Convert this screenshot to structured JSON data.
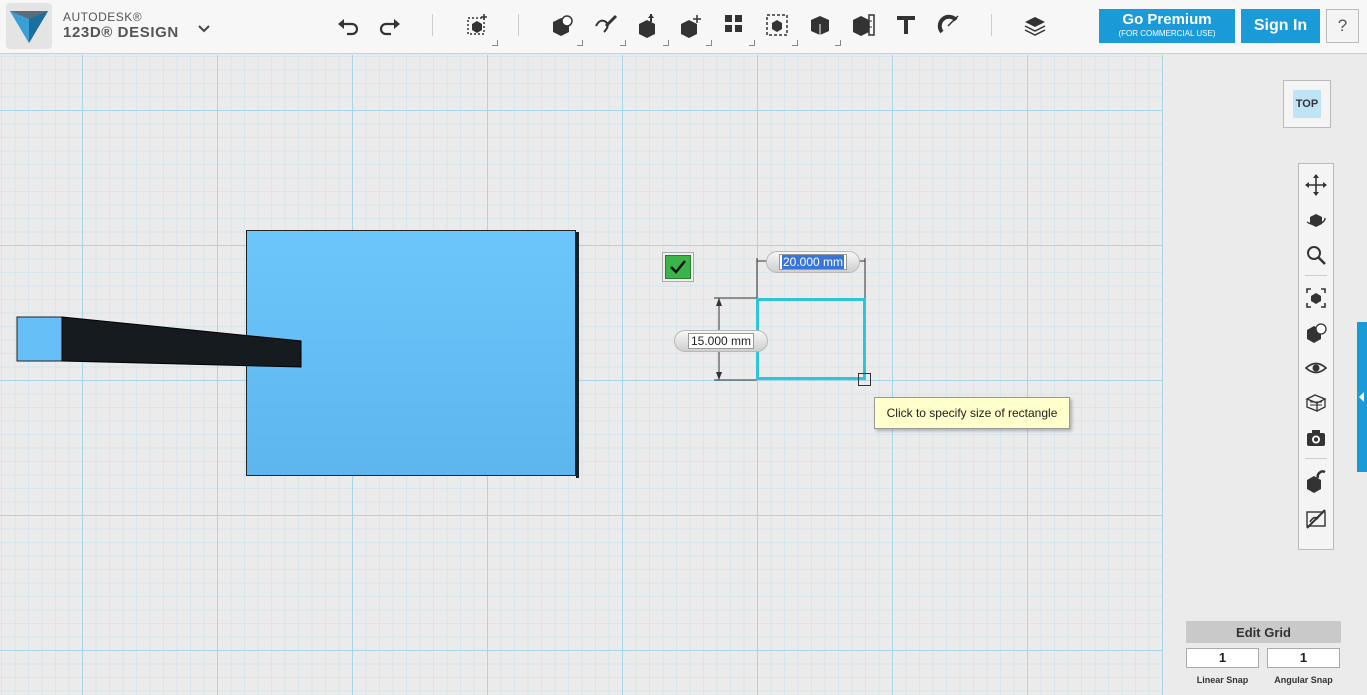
{
  "app": {
    "brand_line1": "AUTODESK®",
    "brand_line2": "123D® DESIGN"
  },
  "toolbar": {
    "tools": [
      {
        "name": "undo-icon"
      },
      {
        "name": "redo-icon"
      },
      {
        "name": "transform-icon"
      },
      {
        "name": "primitives-icon"
      },
      {
        "name": "sketch-icon"
      },
      {
        "name": "construct-icon"
      },
      {
        "name": "modify-icon"
      },
      {
        "name": "pattern-icon"
      },
      {
        "name": "grouping-icon"
      },
      {
        "name": "combine-icon"
      },
      {
        "name": "measure-icon"
      },
      {
        "name": "text-icon"
      },
      {
        "name": "snap-icon"
      },
      {
        "name": "materials-icon"
      }
    ],
    "premium_label": "Go Premium",
    "premium_sublabel": "(FOR COMMERCIAL USE)",
    "signin_label": "Sign In",
    "help_label": "?"
  },
  "viewcube": {
    "face_label": "TOP"
  },
  "navigation": [
    "pan-icon",
    "orbit-icon",
    "zoom-icon",
    "fit-icon",
    "view-icon",
    "visibility-icon",
    "materials-outline-icon",
    "screenshot-icon",
    "snap-settings-icon",
    "hide-sketch-icon"
  ],
  "sketch": {
    "width_value": "20.000 mm",
    "height_value": "15.000 mm",
    "tooltip": "Click to specify size of rectangle"
  },
  "grid": {
    "header": "Edit Grid",
    "linear_snap_value": "1",
    "angular_snap_value": "1",
    "linear_snap_label": "Linear Snap",
    "angular_snap_label": "Angular Snap"
  },
  "colors": {
    "accent": "#1a9ad6",
    "box_fill": "#66c0f7",
    "sketch_outline": "#2ec5d9",
    "confirm_green": "#3bb54a"
  }
}
